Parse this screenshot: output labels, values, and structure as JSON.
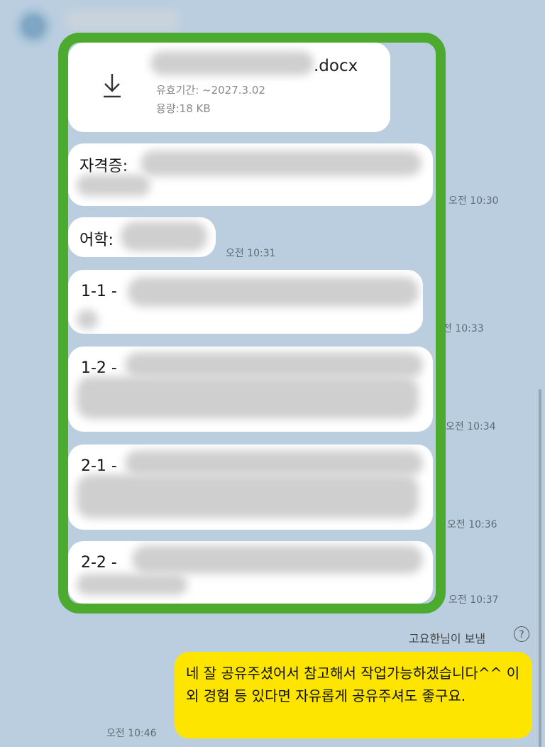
{
  "header": {
    "avatar_icon": "avatar-icon"
  },
  "file": {
    "name_suffix": ".docx",
    "expiry": "유효기간: ~2027.3.02",
    "size": "용량:18 KB",
    "icon": "download-icon"
  },
  "messages": [
    {
      "label": "자격증:",
      "time": "오전 10:30"
    },
    {
      "label": "어학:",
      "time": "오전 10:31"
    },
    {
      "label": "1-1 -",
      "time": "전 10:33"
    },
    {
      "label": "1-2 -",
      "time": "오전 10:34"
    },
    {
      "label": "2-1 -",
      "time": "오전 10:36"
    },
    {
      "label": "2-2 -",
      "time": "오전 10:37"
    }
  ],
  "sent": {
    "sender": "고요한님이 보냄",
    "help_icon": "?",
    "text": "네 잘 공유주셨어서 참고해서 작업가능하겠습니다^^ 이외 경험 등 있다면 자유롭게 공유주셔도 좋구요.",
    "time": "오전 10:46"
  },
  "colors": {
    "background": "#bacee0",
    "frame": "#4caa2f",
    "my_bubble": "#fee500",
    "bubble": "#ffffff"
  }
}
